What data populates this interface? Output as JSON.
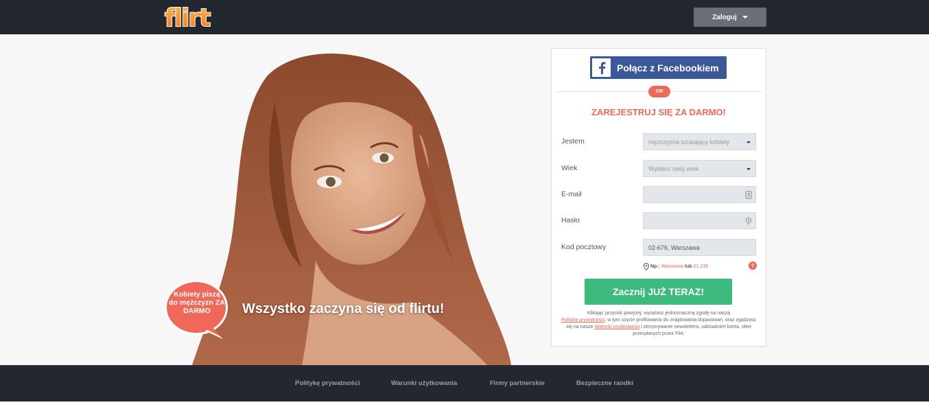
{
  "header": {
    "logo_text": "flirt",
    "login_label": "Zaloguj"
  },
  "hero": {
    "bubble_text": "Kobiety piszą do mężczyzn ZA DARMO",
    "tagline": "Wszystko zaczyna się od flirtu!"
  },
  "signup": {
    "facebook_label": "Połącz z Facebookiem",
    "or_label": "OR",
    "title": "ZAREJESTRUJ SIĘ ZA DARMO!",
    "fields": [
      {
        "label": "Jestem",
        "value": "mężczyzna szukający kobiety"
      },
      {
        "label": "Wiek",
        "value": "Wybierz swój wiek"
      },
      {
        "label": "E-mail",
        "value": ""
      },
      {
        "label": "Hasło",
        "value": ""
      },
      {
        "label": "Kod pocztowy",
        "value": "02-676, Warszawa"
      }
    ],
    "hint": {
      "prefix": "Np.:",
      "example_city": "Warszawa",
      "or_word": "lub",
      "example_code": "01-236"
    },
    "help_label": "?",
    "cta_label": "Zacznij JUŻ TERAZ!",
    "terms": {
      "part1": "Klikając przycisk powyżej, wyrażasz jednoznaczną zgodę na naszą",
      "privacy_link": "Politykę prywatności",
      "part2": ", w tym użycie profilowania do znajdowania dopasowań, oraz zgadzasz się na nasze",
      "terms_link": "Warunki użytkowania",
      "part3": "i otrzymywanie newslettera, uaktualnień konta, ofert przesyłanych przez Flirt."
    }
  },
  "footer": {
    "links": [
      "Politykę prywatności",
      "Warunki użytkowania",
      "Firmy partnerskie",
      "Bezpieczne randki"
    ]
  },
  "colors": {
    "dark": "#232730",
    "accent": "#f0685a",
    "facebook": "#3b5998",
    "cta": "#3dbb7e",
    "logo_orange": "#f79b2e"
  }
}
